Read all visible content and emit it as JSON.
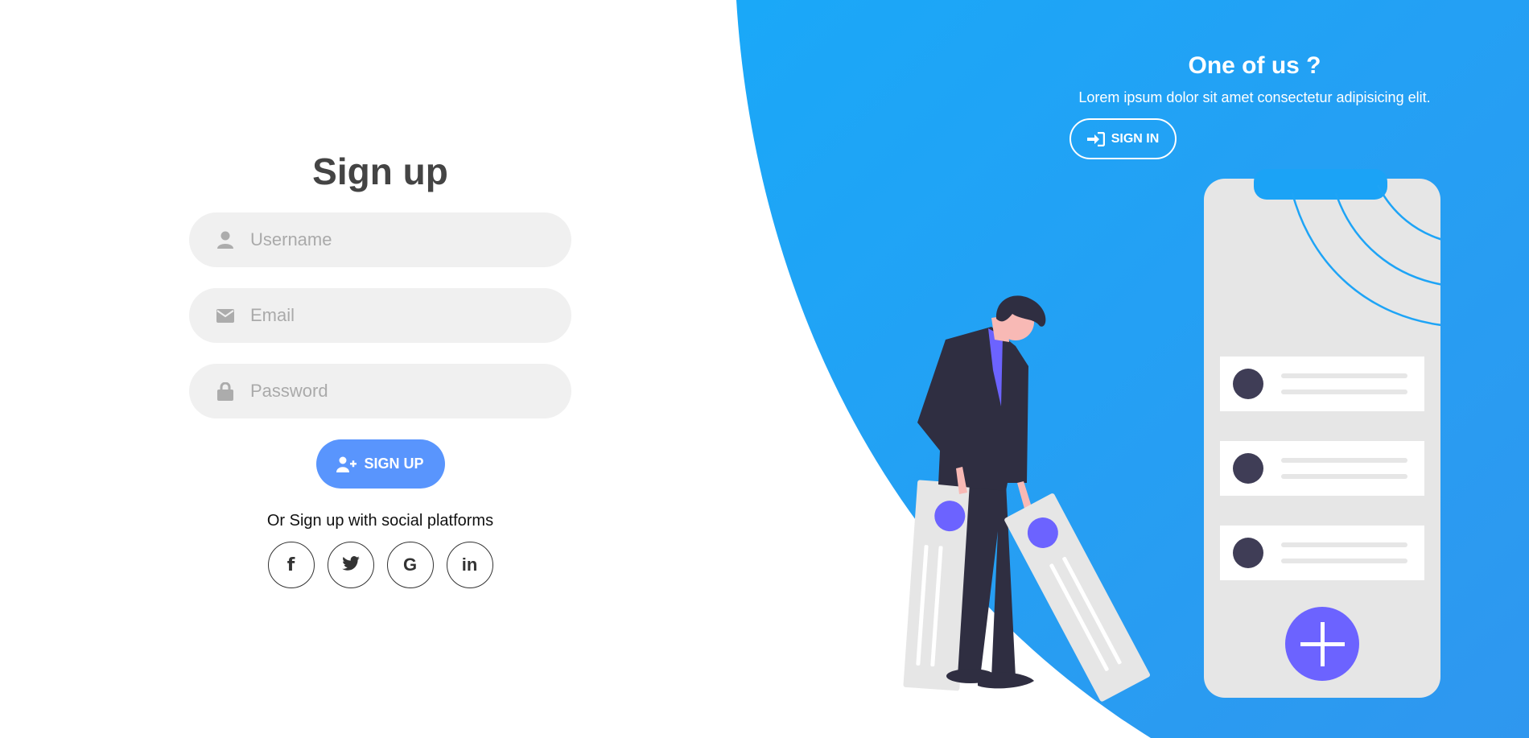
{
  "signup_form": {
    "title": "Sign up",
    "username_placeholder": "Username",
    "email_placeholder": "Email",
    "password_placeholder": "Password",
    "submit_label": "SIGN UP",
    "social_text": "Or Sign up with social platforms",
    "social": [
      {
        "name": "facebook",
        "glyph": "f"
      },
      {
        "name": "twitter",
        "glyph": "twitter-icon"
      },
      {
        "name": "google",
        "glyph": "G"
      },
      {
        "name": "linkedin",
        "glyph": "in"
      }
    ]
  },
  "side_panel": {
    "title": "One of us ?",
    "text": "Lorem ipsum dolor sit amet consectetur adipisicing elit.",
    "signin_label": "SIGN IN"
  },
  "colors": {
    "accent": "#5995fd",
    "panel_gradient_start": "#1aa8f8",
    "panel_gradient_end": "#2f97ef",
    "input_bg": "#f0f0f0",
    "title": "#444444",
    "figure_dark": "#2f2e41",
    "figure_purple": "#6c63ff"
  }
}
